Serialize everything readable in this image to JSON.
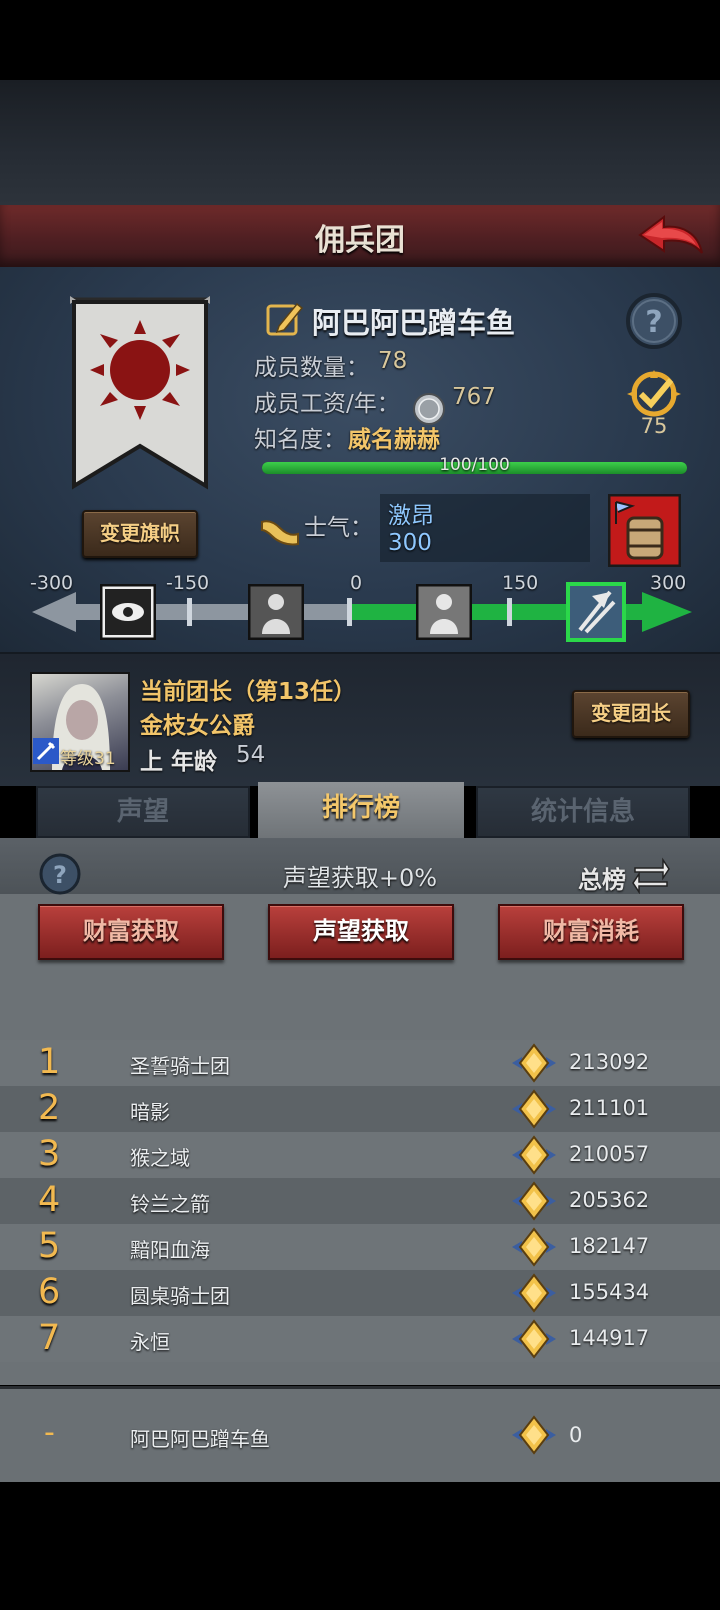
{
  "header": {
    "title": "佣兵团"
  },
  "guild": {
    "name": "阿巴阿巴蹭车鱼",
    "members_label": "成员数量：",
    "members_value": "78",
    "salary_label": "成员工资/年：",
    "salary_value": "767",
    "fame_label": "知名度：",
    "fame_value": "威名赫赫",
    "fame_progress_text": "100/100",
    "fame_progress_fraction": 1.0,
    "rank_value": "75",
    "change_banner_label": "变更旗帜",
    "morale_label": "士气：",
    "morale_state": "激昂",
    "morale_value": "300"
  },
  "morale_scale": {
    "ticks": [
      "-300",
      "-150",
      "0",
      "150",
      "300"
    ],
    "current": 300
  },
  "leader": {
    "title": "当前团长（第13任）",
    "name": "金枝女公爵",
    "age_label": "上 年龄",
    "age_value": "54",
    "level_label": "等级31",
    "change_leader_label": "变更团长"
  },
  "tabs": [
    {
      "label": "声望",
      "active": false
    },
    {
      "label": "排行榜",
      "active": true
    },
    {
      "label": "统计信息",
      "active": false
    }
  ],
  "ranking": {
    "bonus_text": "声望获取+0%",
    "total_label": "总榜",
    "filters": [
      "财富获取",
      "声望获取",
      "财富消耗"
    ],
    "rows": [
      {
        "rank": "1",
        "name": "圣誓骑士团",
        "score": "213092"
      },
      {
        "rank": "2",
        "name": "暗影",
        "score": "211101"
      },
      {
        "rank": "3",
        "name": "猴之域",
        "score": "210057"
      },
      {
        "rank": "4",
        "name": "铃兰之箭",
        "score": "205362"
      },
      {
        "rank": "5",
        "name": "黯阳血海",
        "score": "182147"
      },
      {
        "rank": "6",
        "name": "圆桌骑士团",
        "score": "155434"
      },
      {
        "rank": "7",
        "name": "永恒",
        "score": "144917"
      }
    ],
    "my_row": {
      "rank": "-",
      "name": "阿巴阿巴蹭车鱼",
      "score": "0"
    }
  },
  "colors": {
    "title_bar": "#5a2326",
    "gold_text": "#f2c56a",
    "active_tab_text": "#f4c86b",
    "fame_bar": "#2aa83a",
    "red_button": "#9a302e"
  },
  "icons": [
    "edit-icon",
    "help-icon",
    "coin-icon",
    "rank-badge-icon",
    "horn-icon",
    "barrel-icon",
    "back-arrow-icon",
    "swap-icon",
    "medal-icon"
  ]
}
